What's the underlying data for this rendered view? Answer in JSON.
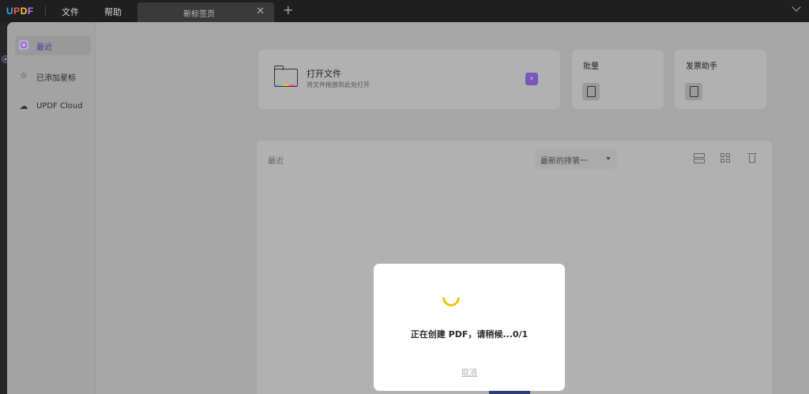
{
  "app": {
    "logo": {
      "u": "U",
      "p": "P",
      "d": "D",
      "f": "F"
    },
    "menus": [
      "文件",
      "帮助"
    ],
    "tab": {
      "label": "新标签页",
      "close": "✕"
    },
    "add_tab": "+"
  },
  "sidebar": {
    "items": [
      {
        "label": "最近",
        "icon": "clock-icon",
        "active": true
      },
      {
        "label": "已添加星标",
        "icon": "star-icon",
        "active": false
      },
      {
        "label": "UPDF Cloud",
        "icon": "cloud-icon",
        "active": false
      }
    ]
  },
  "cards": {
    "open": {
      "title": "打开文件",
      "subtitle": "将文件拖放到此处打开",
      "arrow": "›"
    },
    "batch": {
      "title": "批量"
    },
    "invoice": {
      "title": "发票助手"
    }
  },
  "recent": {
    "title": "最近",
    "sort_label": "最新的排第一"
  },
  "modal": {
    "message": "正在创建 PDF，请稍候...0/1",
    "cancel": "取消"
  },
  "colors": {
    "accent": "#7b57b9",
    "spinner": "#f5c400"
  }
}
